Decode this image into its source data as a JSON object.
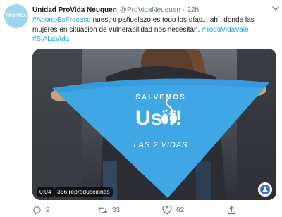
{
  "tweet": {
    "author_name": "Unidad ProVida Neuquen",
    "handle": "@ProVidaNeuquen",
    "separator": "·",
    "time": "22h",
    "avatar_text": "PRO VIDA",
    "text": {
      "hashtag1": "#AbortoEsFracaso",
      "body": " nuestro pañuelazo es todo los días... ahí, donde las mujeres en situación de vulnerabilidad nos necesitan. ",
      "hashtag2": "#TodaVidaVale",
      "hashtag3": "#SiALaVida"
    },
    "media": {
      "scarf_top": "SALVEMOS",
      "scarf_main": "Us     !!",
      "scarf_bottom": "LAS 2 VIDAS",
      "duration": "0:04",
      "views": "356 reproducciones"
    },
    "actions": {
      "replies": "2",
      "retweets": "33",
      "likes": "62"
    },
    "colors": {
      "hashtag": "#1da1f2",
      "scarf": "#3fa7e6",
      "meta": "#657786"
    }
  }
}
